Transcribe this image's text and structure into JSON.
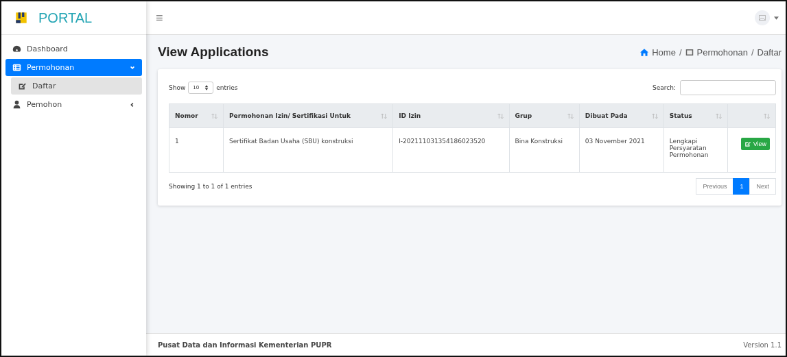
{
  "brand": {
    "title": "PORTAL"
  },
  "sidebar": {
    "items": [
      {
        "label": "Dashboard",
        "selected": false
      },
      {
        "label": "Permohonan",
        "selected": true,
        "expanded": true,
        "children": [
          {
            "label": "Daftar",
            "selected": true
          }
        ]
      },
      {
        "label": "Pemohon",
        "selected": false,
        "expanded": false
      }
    ]
  },
  "topbar": {
    "menu": "≡"
  },
  "page": {
    "title": "View Applications",
    "breadcrumb": [
      "Home",
      "Permohonan",
      "Daftar"
    ],
    "separator": "/"
  },
  "table_controls": {
    "show_label": "Show",
    "page_size": "10",
    "entries_label": "entries",
    "search_label": "Search:"
  },
  "table": {
    "columns": [
      "Nomor",
      "Permohonan Izin/ Sertifikasi Untuk",
      "ID Izin",
      "Grup",
      "Dibuat Pada",
      "Status"
    ],
    "rows": [
      {
        "cells": [
          "1",
          "Sertifikat Badan Usaha (SBU) konstruksi",
          "I-202111031354186023520",
          "Bina Konstruksi",
          "03 November 2021",
          "Lengkapi Persyaratan Permohonan"
        ],
        "action": "View"
      }
    ]
  },
  "info": "Showing 1 to 1 of 1 entries",
  "pagination": [
    {
      "label": "Previous",
      "selected": false
    },
    {
      "label": "1",
      "selected": true
    },
    {
      "label": "Next",
      "selected": false
    }
  ],
  "footer": {
    "text": "Pusat Data dan Informasi Kementerian PUPR",
    "version": "Version 1.1"
  }
}
